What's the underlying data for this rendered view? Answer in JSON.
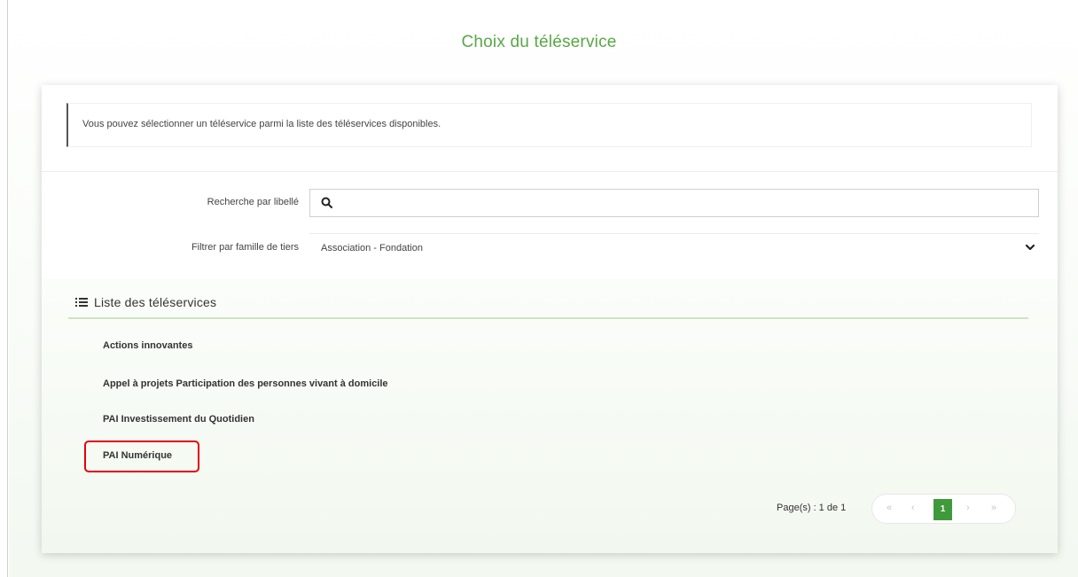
{
  "page": {
    "title": "Choix du téléservice"
  },
  "info": {
    "text": "Vous pouvez sélectionner un téléservice parmi la liste des téléservices disponibles."
  },
  "filters": {
    "search_label": "Recherche par libellé",
    "search_value": "",
    "family_label": "Filtrer par famille de tiers",
    "family_value": "Association - Fondation"
  },
  "list": {
    "title": "Liste des téléservices",
    "items": [
      "Actions innovantes",
      "Appel à projets Participation des personnes vivant à domicile",
      "PAI Investissement du Quotidien",
      "PAI Numérique"
    ],
    "highlighted_item": "PAI Numérique"
  },
  "pagination": {
    "info": "Page(s) : 1 de 1",
    "first": "«",
    "prev": "‹",
    "current": "1",
    "next": "›",
    "last": "»"
  },
  "colors": {
    "accent": "#58a845",
    "pager_active": "#3f9a3b",
    "highlight": "#e3000f"
  },
  "icons": {
    "search": "search-icon",
    "select": "chevron-down-icon",
    "list": "list-icon"
  }
}
